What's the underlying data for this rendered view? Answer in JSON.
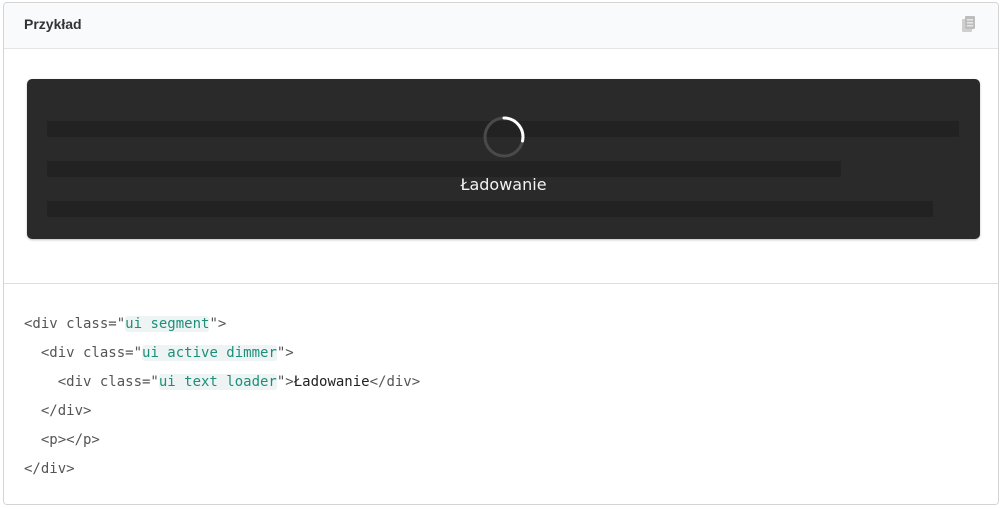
{
  "header": {
    "title": "Przykład",
    "copy_icon": "copy-icon"
  },
  "example": {
    "loader_text": "Ładowanie"
  },
  "code": {
    "line1_open": "<div class=\"",
    "line1_val": "ui segment",
    "line1_close": "\">",
    "line2_open": "  <div class=\"",
    "line2_val": "ui active dimmer",
    "line2_close": "\">",
    "line3_open": "    <div class=\"",
    "line3_val": "ui text loader",
    "line3_mid": "\">",
    "line3_text": "Ładowanie",
    "line3_close": "</div>",
    "line4": "  </div>",
    "line5": "  <p></p>",
    "line6": "</div>"
  },
  "colors": {
    "segment_bg": "#2a2a2a",
    "attr_value": "#1c8f7a",
    "header_bg": "#f9fafb"
  }
}
